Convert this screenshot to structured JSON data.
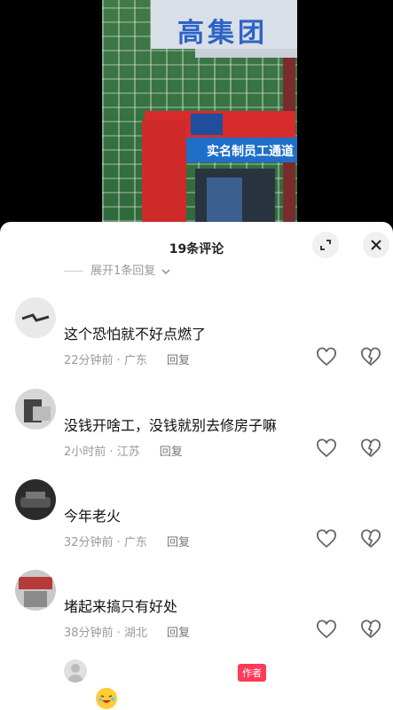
{
  "video": {
    "sign_top_text": "高集团",
    "booth_text": "实名制员工通道"
  },
  "panel": {
    "title": "19条评论",
    "expand_text": "展开1条回复"
  },
  "comments": [
    {
      "text": "这个恐怕就不好点燃了",
      "time": "22分钟前",
      "location": "广东",
      "reply": "回复"
    },
    {
      "text": "没钱开啥工，没钱就别去修房子嘛",
      "time": "2小时前",
      "location": "江苏",
      "reply": "回复"
    },
    {
      "text": "今年老火",
      "time": "32分钟前",
      "location": "广东",
      "reply": "回复"
    },
    {
      "text": "堵起来搞只有好处",
      "time": "38分钟前",
      "location": "湖北",
      "reply": "回复"
    }
  ],
  "last": {
    "author_badge": "作者"
  },
  "icons": {
    "expand": "expand-icon",
    "close": "close-icon",
    "like": "heart-icon",
    "dislike": "broken-heart-icon"
  },
  "colors": {
    "author_badge": "#ff3a5a",
    "meta_text": "#9a9a9a"
  }
}
